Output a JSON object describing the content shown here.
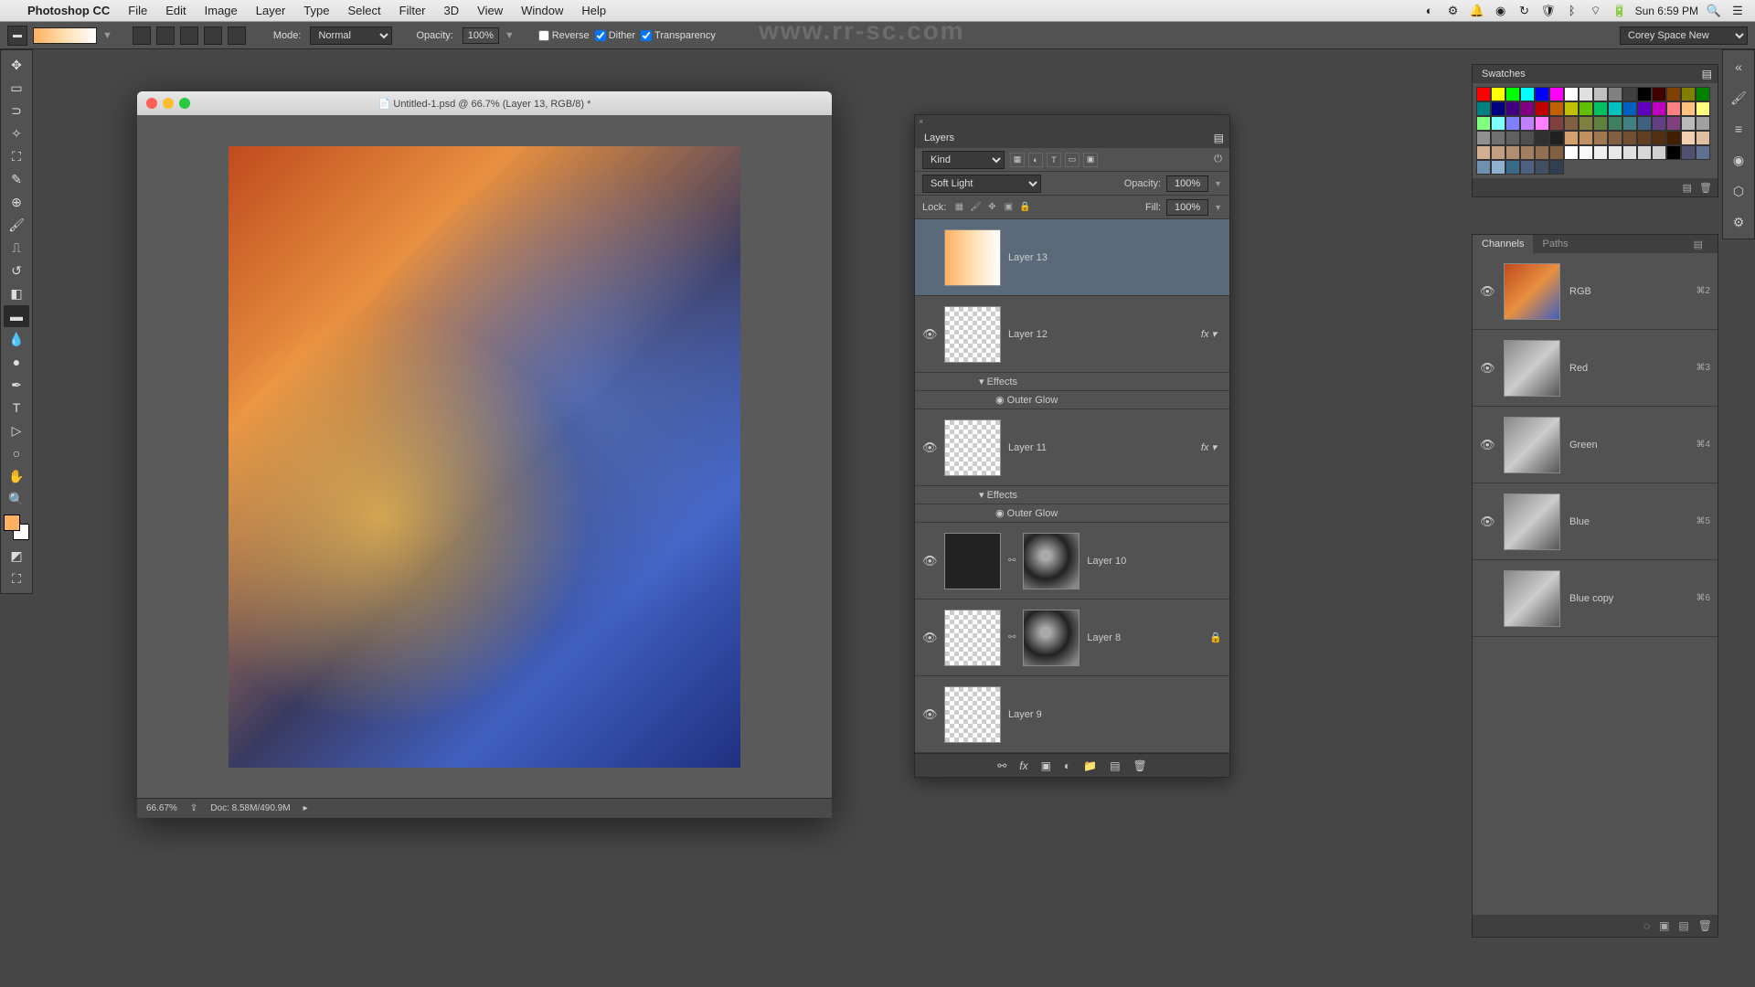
{
  "menubar": {
    "appname": "Photoshop CC",
    "items": [
      "File",
      "Edit",
      "Image",
      "Layer",
      "Type",
      "Select",
      "Filter",
      "3D",
      "View",
      "Window",
      "Help"
    ],
    "clock": "Sun 6:59 PM"
  },
  "options_bar": {
    "mode_label": "Mode:",
    "mode_value": "Normal",
    "opacity_label": "Opacity:",
    "opacity_value": "100%",
    "reverse": "Reverse",
    "dither": "Dither",
    "transparency": "Transparency",
    "workspace": "Corey Space New"
  },
  "document": {
    "title": "Untitled-1.psd @ 66.7% (Layer 13, RGB/8) *",
    "zoom": "66.67%",
    "doc_info": "Doc: 8.58M/490.9M"
  },
  "layers_panel": {
    "title": "Layers",
    "filter_label": "Kind",
    "blend_mode": "Soft Light",
    "opacity_label": "Opacity:",
    "opacity_value": "100%",
    "lock_label": "Lock:",
    "fill_label": "Fill:",
    "fill_value": "100%",
    "effects_label": "Effects",
    "outer_glow_label": "Outer Glow",
    "layers": [
      {
        "name": "Layer 13",
        "selected": true,
        "thumb": "grad",
        "fx": false,
        "mask": false,
        "eye": false
      },
      {
        "name": "Layer 12",
        "selected": false,
        "thumb": "plain",
        "fx": true,
        "mask": false,
        "eye": true
      },
      {
        "name": "Layer 11",
        "selected": false,
        "thumb": "plain",
        "fx": true,
        "mask": false,
        "eye": true
      },
      {
        "name": "Layer 10",
        "selected": false,
        "thumb": "dark",
        "fx": false,
        "mask": true,
        "eye": true
      },
      {
        "name": "Layer 8",
        "selected": false,
        "thumb": "plain",
        "fx": false,
        "mask": true,
        "eye": true,
        "locked": true
      },
      {
        "name": "Layer 9",
        "selected": false,
        "thumb": "plain",
        "fx": false,
        "mask": false,
        "eye": true
      }
    ]
  },
  "swatches_panel": {
    "title": "Swatches",
    "colors": [
      "#ff0000",
      "#ffff00",
      "#00ff00",
      "#00ffff",
      "#0000ff",
      "#ff00ff",
      "#ffffff",
      "#e0e0e0",
      "#c0c0c0",
      "#808080",
      "#404040",
      "#000000",
      "#400000",
      "#804000",
      "#808000",
      "#008000",
      "#008080",
      "#000080",
      "#400080",
      "#800080",
      "#c00000",
      "#c06000",
      "#c0c000",
      "#60c000",
      "#00c060",
      "#00c0c0",
      "#0060c0",
      "#6000c0",
      "#c000c0",
      "#ff8080",
      "#ffc080",
      "#ffff80",
      "#80ff80",
      "#80ffff",
      "#8080ff",
      "#c080ff",
      "#ff80ff",
      "#804040",
      "#806040",
      "#808040",
      "#608040",
      "#408060",
      "#408080",
      "#406080",
      "#604080",
      "#804080",
      "#bababa",
      "#a0a0a0",
      "#909090",
      "#707070",
      "#606060",
      "#505050",
      "#303030",
      "#202020",
      "#d4a070",
      "#c09060",
      "#a07850",
      "#806040",
      "#705030",
      "#604020",
      "#503010",
      "#402000",
      "#f0d0b0",
      "#e0c0a0",
      "#d0b090",
      "#c0a080",
      "#b09070",
      "#a08060",
      "#907050",
      "#806040",
      "#ffffff",
      "#f8f8f8",
      "#f0f0f0",
      "#e8e8e8",
      "#e0e0e0",
      "#d8d8d8",
      "#d0d0d0",
      "#000000",
      "#505070",
      "#607090",
      "#7090b0",
      "#90b0d0",
      "#3a6a8a",
      "#506080",
      "#405060",
      "#304050"
    ]
  },
  "channels_panel": {
    "tab_channels": "Channels",
    "tab_paths": "Paths",
    "channels": [
      {
        "name": "RGB",
        "shortcut": "⌘2",
        "thumb": "rgb",
        "visible": true
      },
      {
        "name": "Red",
        "shortcut": "⌘3",
        "thumb": "gray",
        "visible": true
      },
      {
        "name": "Green",
        "shortcut": "⌘4",
        "thumb": "gray",
        "visible": true
      },
      {
        "name": "Blue",
        "shortcut": "⌘5",
        "thumb": "gray",
        "visible": true
      },
      {
        "name": "Blue copy",
        "shortcut": "⌘6",
        "thumb": "gray",
        "visible": false
      }
    ]
  },
  "watermark": "www.rr-sc.com"
}
